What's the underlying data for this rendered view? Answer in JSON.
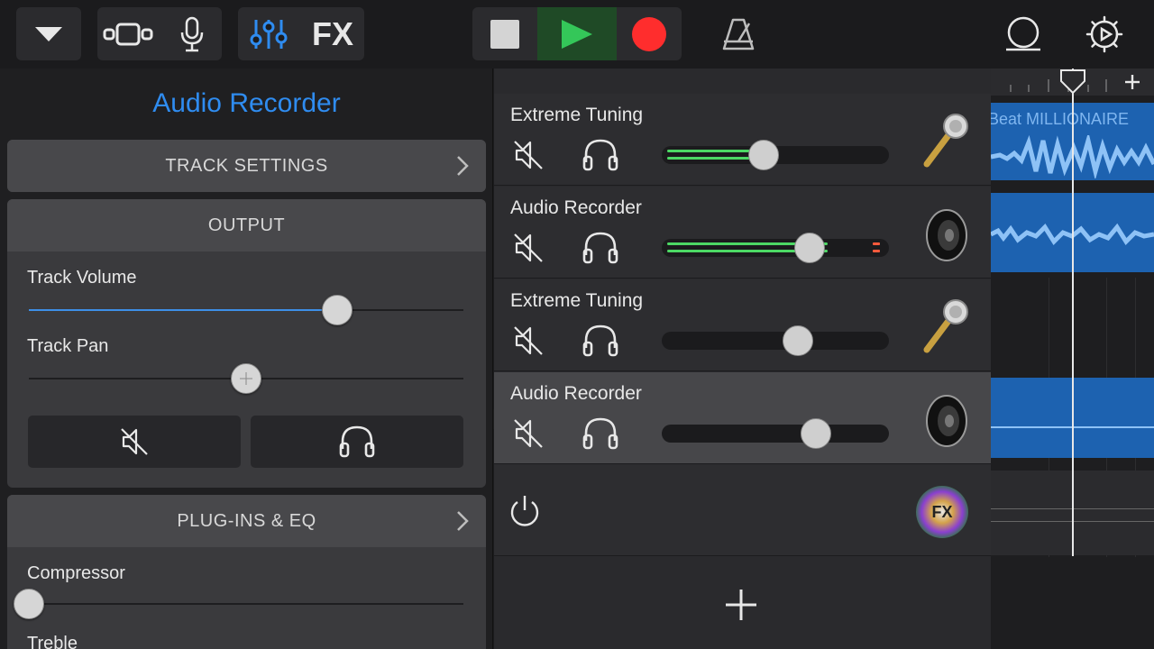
{
  "toolbar": {
    "buttons": [
      {
        "name": "browser-dropdown",
        "icon": "triangle-down-icon"
      },
      {
        "name": "tracks-view",
        "icon": "tracks-view-icon"
      },
      {
        "name": "instrument",
        "icon": "microphone-icon"
      },
      {
        "name": "mixer",
        "icon": "mixer-sliders-icon"
      },
      {
        "name": "fx",
        "label": "FX"
      },
      {
        "name": "stop",
        "icon": "stop-icon"
      },
      {
        "name": "play",
        "icon": "play-icon"
      },
      {
        "name": "record",
        "icon": "record-icon"
      },
      {
        "name": "metronome",
        "icon": "metronome-icon"
      },
      {
        "name": "loops",
        "icon": "loop-icon"
      },
      {
        "name": "settings",
        "icon": "gear-icon"
      }
    ],
    "fx_label": "FX",
    "colors": {
      "accent": "#2f8cf0",
      "play": "#34c759",
      "record": "#ff2d2d"
    }
  },
  "inspector": {
    "title": "Audio Recorder",
    "track_settings_label": "TRACK SETTINGS",
    "output": {
      "header": "OUTPUT",
      "track_volume_label": "Track Volume",
      "track_volume_value": 0.71,
      "track_pan_label": "Track Pan",
      "track_pan_value": 0.5
    },
    "plugins": {
      "header": "PLUG-INS & EQ",
      "compressor_label": "Compressor",
      "compressor_value": 0,
      "treble_label": "Treble"
    }
  },
  "tracks": [
    {
      "name": "Extreme Tuning",
      "volume": 0.45,
      "meter": 0.4,
      "icon": "microphone-icon",
      "selected": false
    },
    {
      "name": "Audio Recorder",
      "volume": 0.65,
      "meter": 0.74,
      "icon": "speaker-icon",
      "selected": false
    },
    {
      "name": "Extreme Tuning",
      "volume": 0.6,
      "meter": 0,
      "icon": "microphone-icon",
      "selected": false
    },
    {
      "name": "Audio Recorder",
      "volume": 0.68,
      "meter": 0,
      "icon": "speaker-icon",
      "selected": true
    }
  ],
  "master_fx": {
    "fx_badge": "FX"
  },
  "timeline": {
    "region_label": "Beat MILLIONAIRE"
  }
}
